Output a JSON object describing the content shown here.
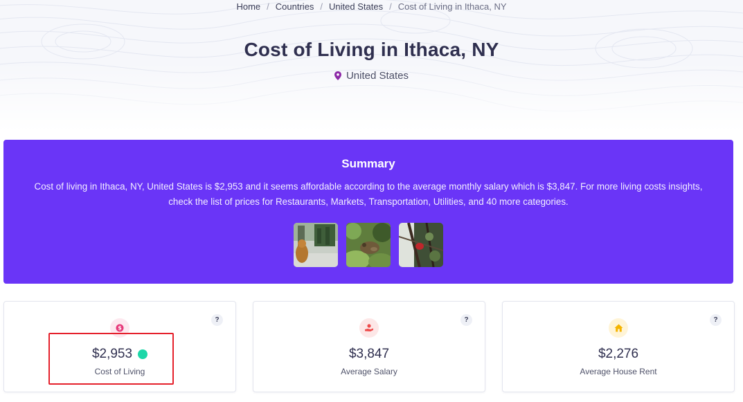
{
  "breadcrumb": {
    "items": [
      "Home",
      "Countries",
      "United States"
    ],
    "separator": "/",
    "current": "Cost of Living in Ithaca, NY"
  },
  "header": {
    "title": "Cost of Living in Ithaca, NY",
    "location": "United States",
    "location_icon": "map-pin-icon"
  },
  "summary": {
    "heading": "Summary",
    "text": "Cost of living in Ithaca, NY, United States is $2,953 and it seems affordable according to the average monthly salary which is $3,847. For more living costs insights, check the list of prices for Restaurants, Markets, Transportation, Utilities, and 40 more categories.",
    "thumbnails": [
      "dog-on-sidewalk-photo",
      "frog-on-moss-photo",
      "red-bird-in-tree-photo"
    ],
    "background_color": "#6a35f7"
  },
  "cards": [
    {
      "value": "$2,953",
      "label": "Cost of Living",
      "icon": "money-icon",
      "icon_color": "#e6397a",
      "icon_bg": "#fde8ef",
      "indicator_color": "#1dd7a8",
      "help": "?"
    },
    {
      "value": "$3,847",
      "label": "Average Salary",
      "icon": "salary-hand-icon",
      "icon_color": "#ee4b4b",
      "icon_bg": "#fde7e7",
      "help": "?"
    },
    {
      "value": "$2,276",
      "label": "Average House Rent",
      "icon": "house-icon",
      "icon_color": "#f5b400",
      "icon_bg": "#fff4d6",
      "help": "?"
    }
  ],
  "highlight_color": "#e5202b"
}
